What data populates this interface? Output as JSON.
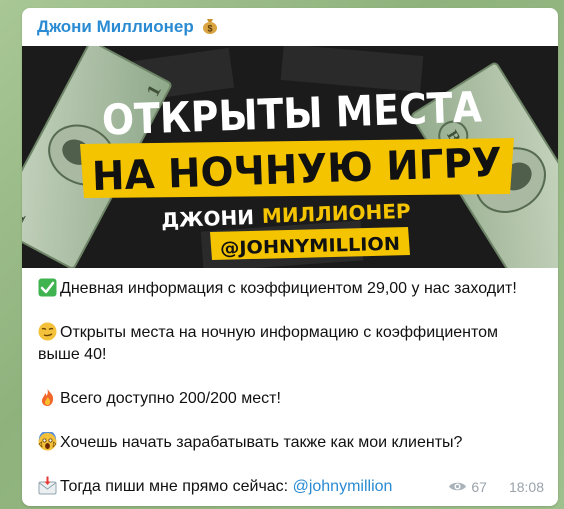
{
  "message": {
    "sender_name": "Джони Миллионер",
    "sender_emoji_icon": "money-bag-icon",
    "banner": {
      "line1": "ОТКРЫТЫ МЕСТА",
      "line2": "НА НОЧНУЮ ИГРУ",
      "brand_name_1": "ДЖОНИ",
      "brand_name_2": "МИЛЛИОНЕР",
      "handle": "@JOHNYMILLION",
      "accent_color": "#f5c400"
    },
    "lines": {
      "line1_text": "Дневная информация с коэффициентом 29,00 у нас заходит!",
      "line1_icon": "green-check-icon",
      "line2a_text": "Открыты места на ночную информацию с коэффициентом",
      "line2b_text": "выше 40!",
      "line2_icon": "smirk-face-icon",
      "line3_text": "Всего доступно 200/200 мест!",
      "line3_icon": "fire-icon",
      "line4_text": "Хочешь начать зарабатывать также как мои клиенты?",
      "line4_icon": "screaming-face-icon",
      "line5_text": "Тогда пиши мне прямо сейчас: ",
      "line5_link": "@johnymillion",
      "line5_icon": "incoming-envelope-icon"
    },
    "views": "67",
    "time": "18:08"
  }
}
